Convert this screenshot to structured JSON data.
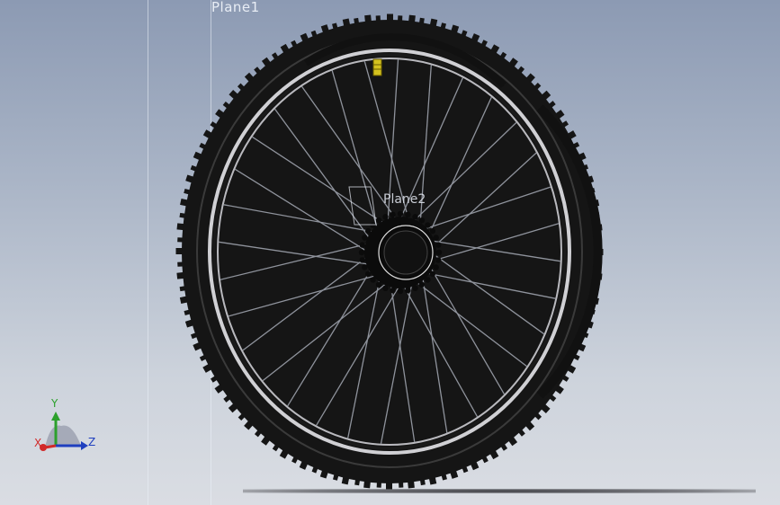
{
  "viewport": {
    "plane_label": "Plane1",
    "plane2_label": "Plane2"
  },
  "triad": {
    "x_label": "X",
    "y_label": "Y",
    "z_label": "Z",
    "x_color": "#d12a2a",
    "y_color": "#2ca02c",
    "z_color": "#1f3fbf"
  },
  "wheel": {
    "tire_color": "#151515",
    "rim_color": "#c8c8cc",
    "spoke_color": "#8f939c",
    "hub_color": "#0b0b0b",
    "valve_color": "#d4c21f",
    "spoke_count": 32
  }
}
